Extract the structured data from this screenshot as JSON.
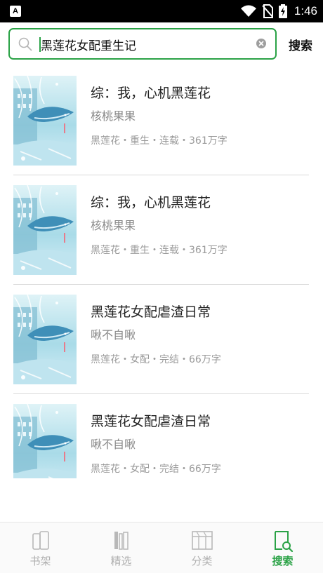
{
  "status_bar": {
    "app_badge": "A",
    "time": "1:46"
  },
  "search": {
    "query": "黑莲花女配重生记",
    "button_label": "搜索"
  },
  "results": [
    {
      "title": "综：我，心机黑莲花",
      "author": "核桃果果",
      "meta": "黑莲花・重生・连载・361万字"
    },
    {
      "title": "综：我，心机黑莲花",
      "author": "核桃果果",
      "meta": "黑莲花・重生・连载・361万字"
    },
    {
      "title": "黑莲花女配虐渣日常",
      "author": "啾不自啾",
      "meta": "黑莲花・女配・完结・66万字"
    },
    {
      "title": "黑莲花女配虐渣日常",
      "author": "啾不自啾",
      "meta": "黑莲花・女配・完结・66万字"
    }
  ],
  "bottom_nav": {
    "tabs": [
      {
        "label": "书架",
        "icon": "bookshelf-icon",
        "active": false
      },
      {
        "label": "精选",
        "icon": "books-icon",
        "active": false
      },
      {
        "label": "分类",
        "icon": "category-icon",
        "active": false
      },
      {
        "label": "搜索",
        "icon": "search-book-icon",
        "active": true
      }
    ]
  },
  "colors": {
    "accent": "#2aa246",
    "muted_text": "#9a9a9a",
    "divider": "#d9d9d9"
  }
}
